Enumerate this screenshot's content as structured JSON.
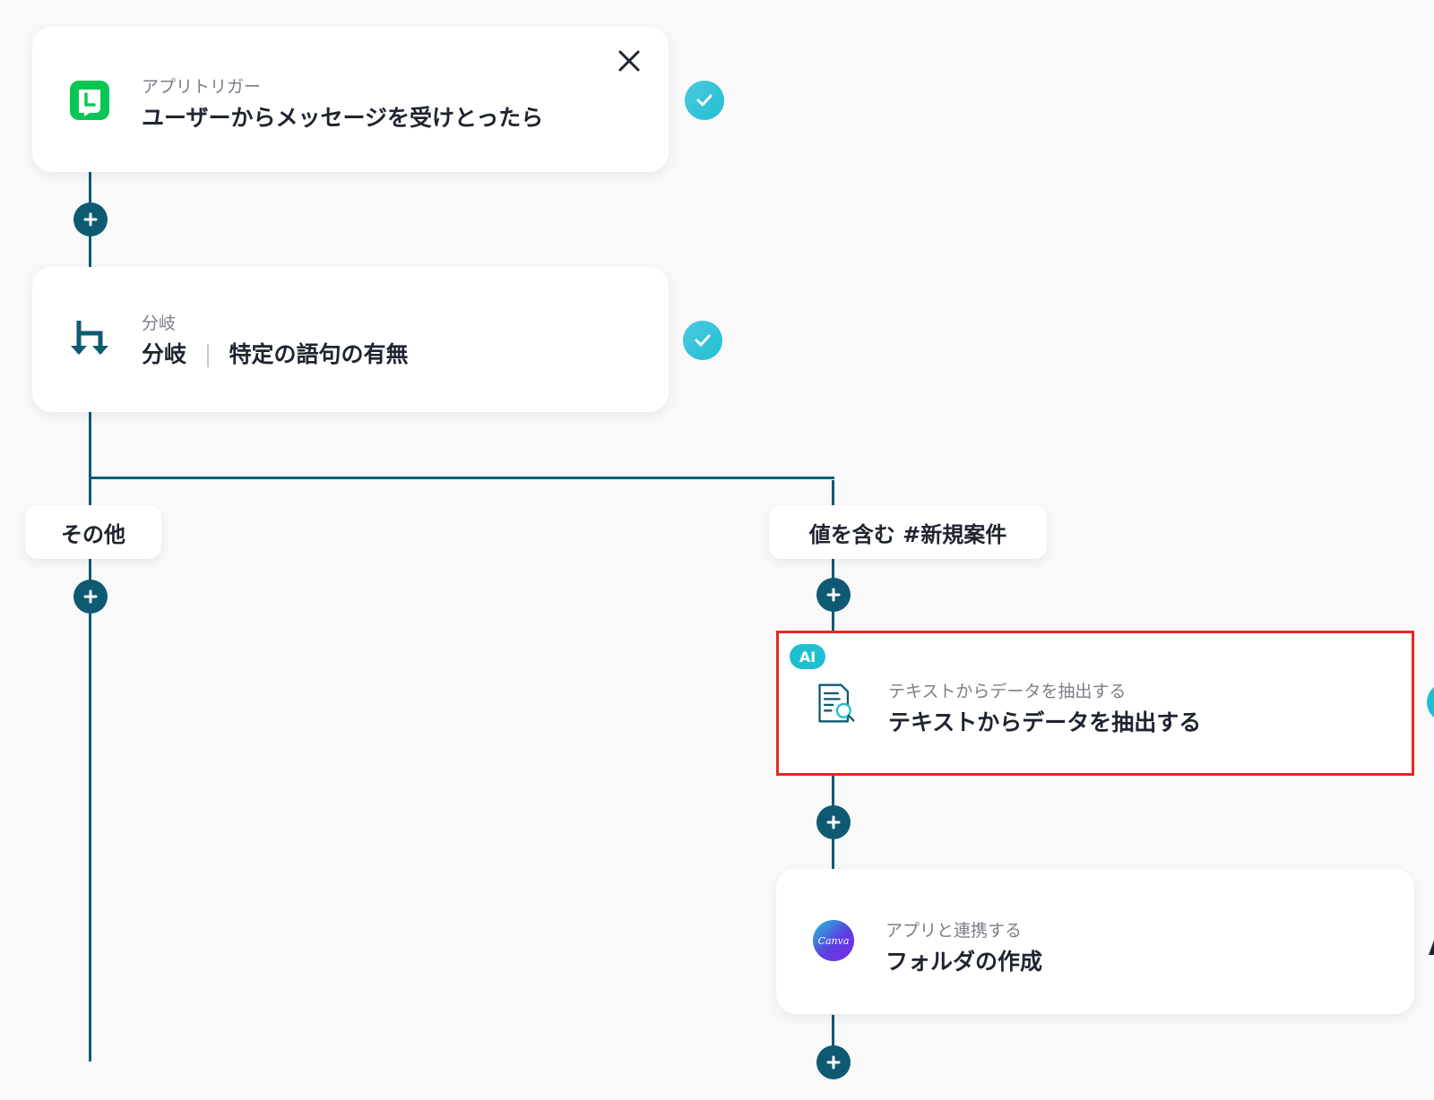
{
  "trigger": {
    "sub": "アプリトリガー",
    "title": "ユーザーからメッセージを受けとったら",
    "icon": "line-app-icon",
    "accent": "#06c755"
  },
  "branch": {
    "sub": "分岐",
    "title_main": "分岐",
    "title_rest": "特定の語句の有無",
    "icon": "branch-icon"
  },
  "branches": {
    "left_label": "その他",
    "right_label": "値を含む #新規案件"
  },
  "ai_step": {
    "badge": "AI",
    "sub": "テキストからデータを抽出する",
    "title": "テキストからデータを抽出する",
    "icon": "document-search-icon",
    "highlight_color": "#e8271f"
  },
  "canva_step": {
    "sub": "アプリと連携する",
    "title": "フォルダの作成",
    "icon": "canva-icon",
    "logo_text": "Canva"
  },
  "colors": {
    "connector": "#0e5a73",
    "check": "#1fbfd0",
    "background": "#f9f9f9"
  }
}
